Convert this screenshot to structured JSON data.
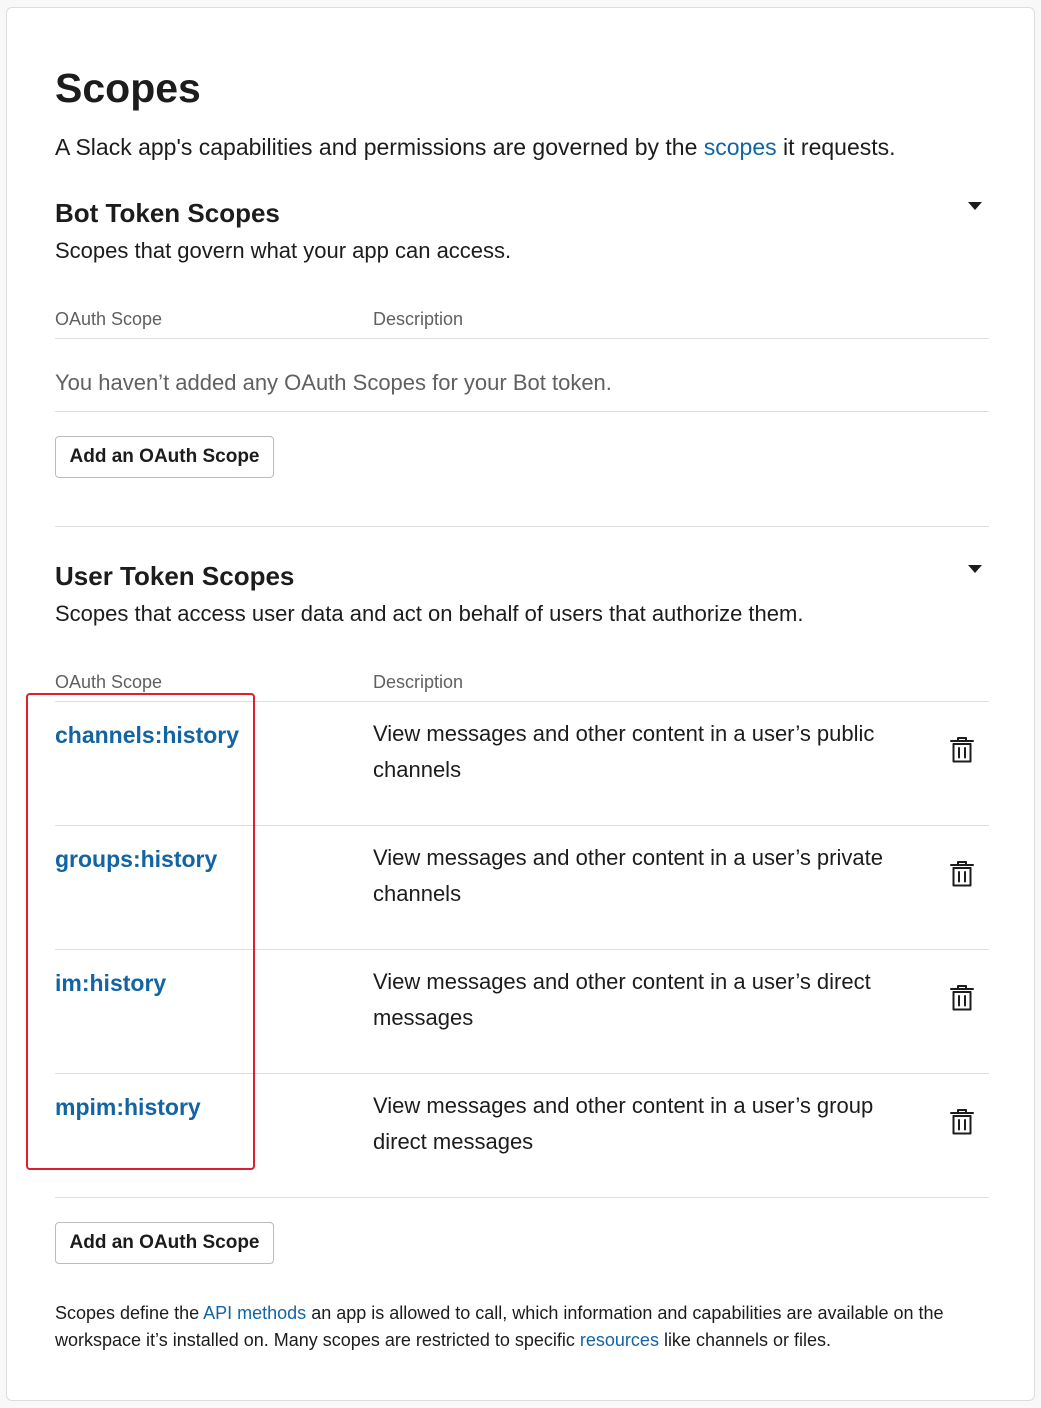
{
  "page": {
    "title": "Scopes",
    "intro_before": "A Slack app's capabilities and permissions are governed by the ",
    "intro_link": "scopes",
    "intro_after": " it requests."
  },
  "bot": {
    "title": "Bot Token Scopes",
    "subtitle": "Scopes that govern what your app can access.",
    "col_scope": "OAuth Scope",
    "col_description": "Description",
    "empty_message": "You haven’t added any OAuth Scopes for your Bot token.",
    "add_button": "Add an OAuth Scope"
  },
  "user": {
    "title": "User Token Scopes",
    "subtitle": "Scopes that access user data and act on behalf of users that authorize them.",
    "col_scope": "OAuth Scope",
    "col_description": "Description",
    "scopes": [
      {
        "name": "channels:history",
        "description": "View messages and other content in a user’s public channels"
      },
      {
        "name": "groups:history",
        "description": "View messages and other content in a user’s private channels"
      },
      {
        "name": "im:history",
        "description": "View messages and other content in a user’s direct messages"
      },
      {
        "name": "mpim:history",
        "description": "View messages and other content in a user’s group direct messages"
      }
    ],
    "add_button": "Add an OAuth Scope"
  },
  "footer": {
    "text_1": "Scopes define the ",
    "link_1": "API methods",
    "text_2": " an app is allowed to call, which information and capabilities are available on the workspace it’s installed on. Many scopes are restricted to specific ",
    "link_2": "resources",
    "text_3": " like channels or files."
  },
  "colors": {
    "link": "#1264a3",
    "highlight_border": "#e01e2f",
    "muted_text": "#616061"
  },
  "icons": {
    "collapse": "caret-down-icon",
    "remove": "trash-icon"
  }
}
